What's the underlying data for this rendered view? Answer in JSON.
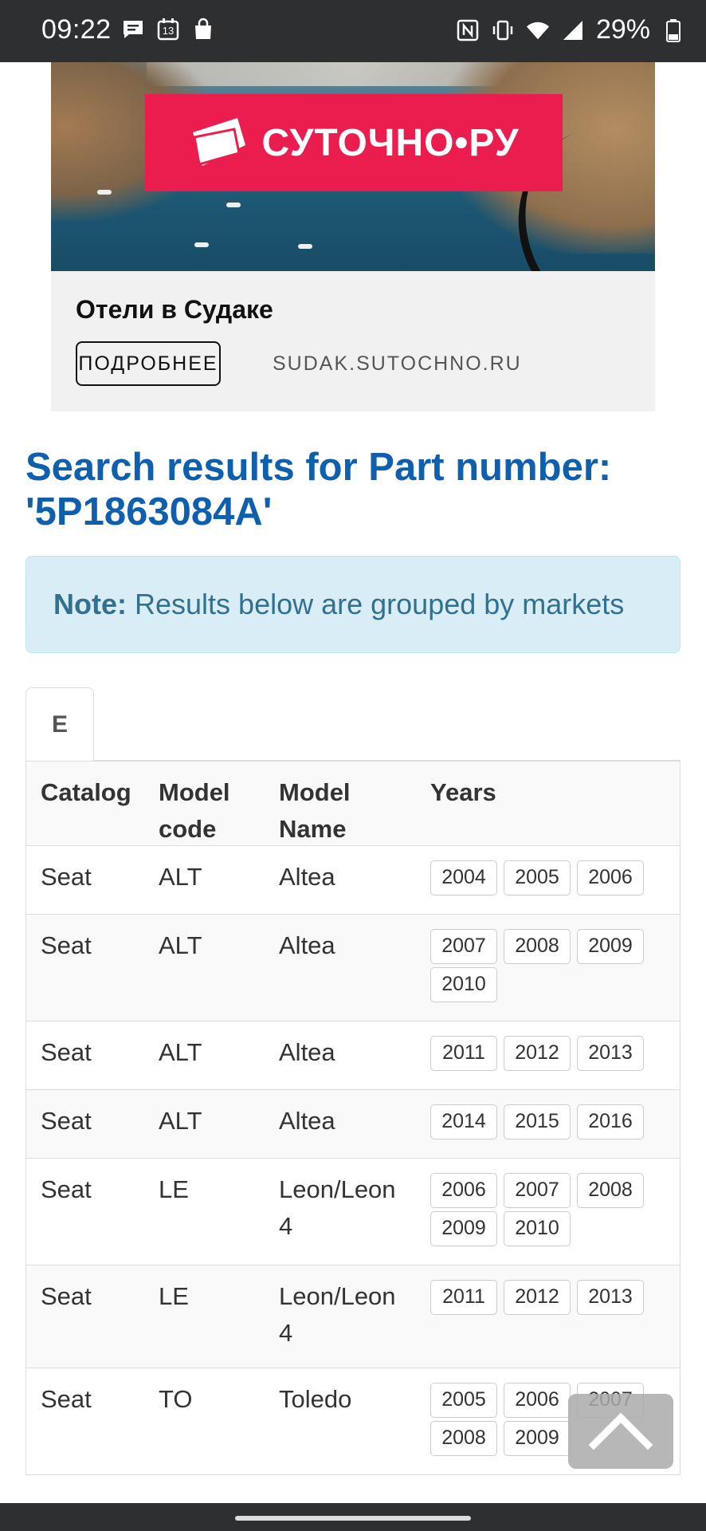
{
  "status_bar": {
    "time": "09:22",
    "calendar_day": "13",
    "battery_percent": "29%",
    "icons_left": [
      "message-icon",
      "calendar-icon",
      "shopping-bag-icon"
    ],
    "icons_right": [
      "nfc-icon",
      "vibrate-icon",
      "wifi-icon",
      "signal-icon",
      "battery-icon"
    ]
  },
  "ad": {
    "logo_text": "СУТОЧНО•РУ",
    "logo_color": "#eb1d4f",
    "title": "Отели в Судаке",
    "button_label": "ПОДРОБНЕЕ",
    "domain": "SUDAK.SUTOCHNO.RU"
  },
  "page": {
    "heading": "Search results for Part number: '5P1863084A'",
    "heading_color": "#0e5fae"
  },
  "note": {
    "label": "Note:",
    "text": "Results below are grouped by markets"
  },
  "tabs": [
    {
      "label": "E",
      "active": true
    }
  ],
  "table": {
    "columns": [
      "Catalog",
      "Model code",
      "Model Name",
      "Years"
    ],
    "rows": [
      {
        "catalog": "Seat",
        "model_code": "ALT",
        "model_name": "Altea",
        "years": [
          "2004",
          "2005",
          "2006"
        ]
      },
      {
        "catalog": "Seat",
        "model_code": "ALT",
        "model_name": "Altea",
        "years": [
          "2007",
          "2008",
          "2009",
          "2010"
        ]
      },
      {
        "catalog": "Seat",
        "model_code": "ALT",
        "model_name": "Altea",
        "years": [
          "2011",
          "2012",
          "2013"
        ]
      },
      {
        "catalog": "Seat",
        "model_code": "ALT",
        "model_name": "Altea",
        "years": [
          "2014",
          "2015",
          "2016"
        ]
      },
      {
        "catalog": "Seat",
        "model_code": "LE",
        "model_name": "Leon/Leon 4",
        "years": [
          "2006",
          "2007",
          "2008",
          "2009",
          "2010"
        ]
      },
      {
        "catalog": "Seat",
        "model_code": "LE",
        "model_name": "Leon/Leon 4",
        "years": [
          "2011",
          "2012",
          "2013"
        ]
      },
      {
        "catalog": "Seat",
        "model_code": "TO",
        "model_name": "Toledo",
        "years": [
          "2005",
          "2006",
          "2007",
          "2008",
          "2009"
        ]
      }
    ]
  },
  "scroll_top": {
    "icon": "chevron-up-icon"
  }
}
